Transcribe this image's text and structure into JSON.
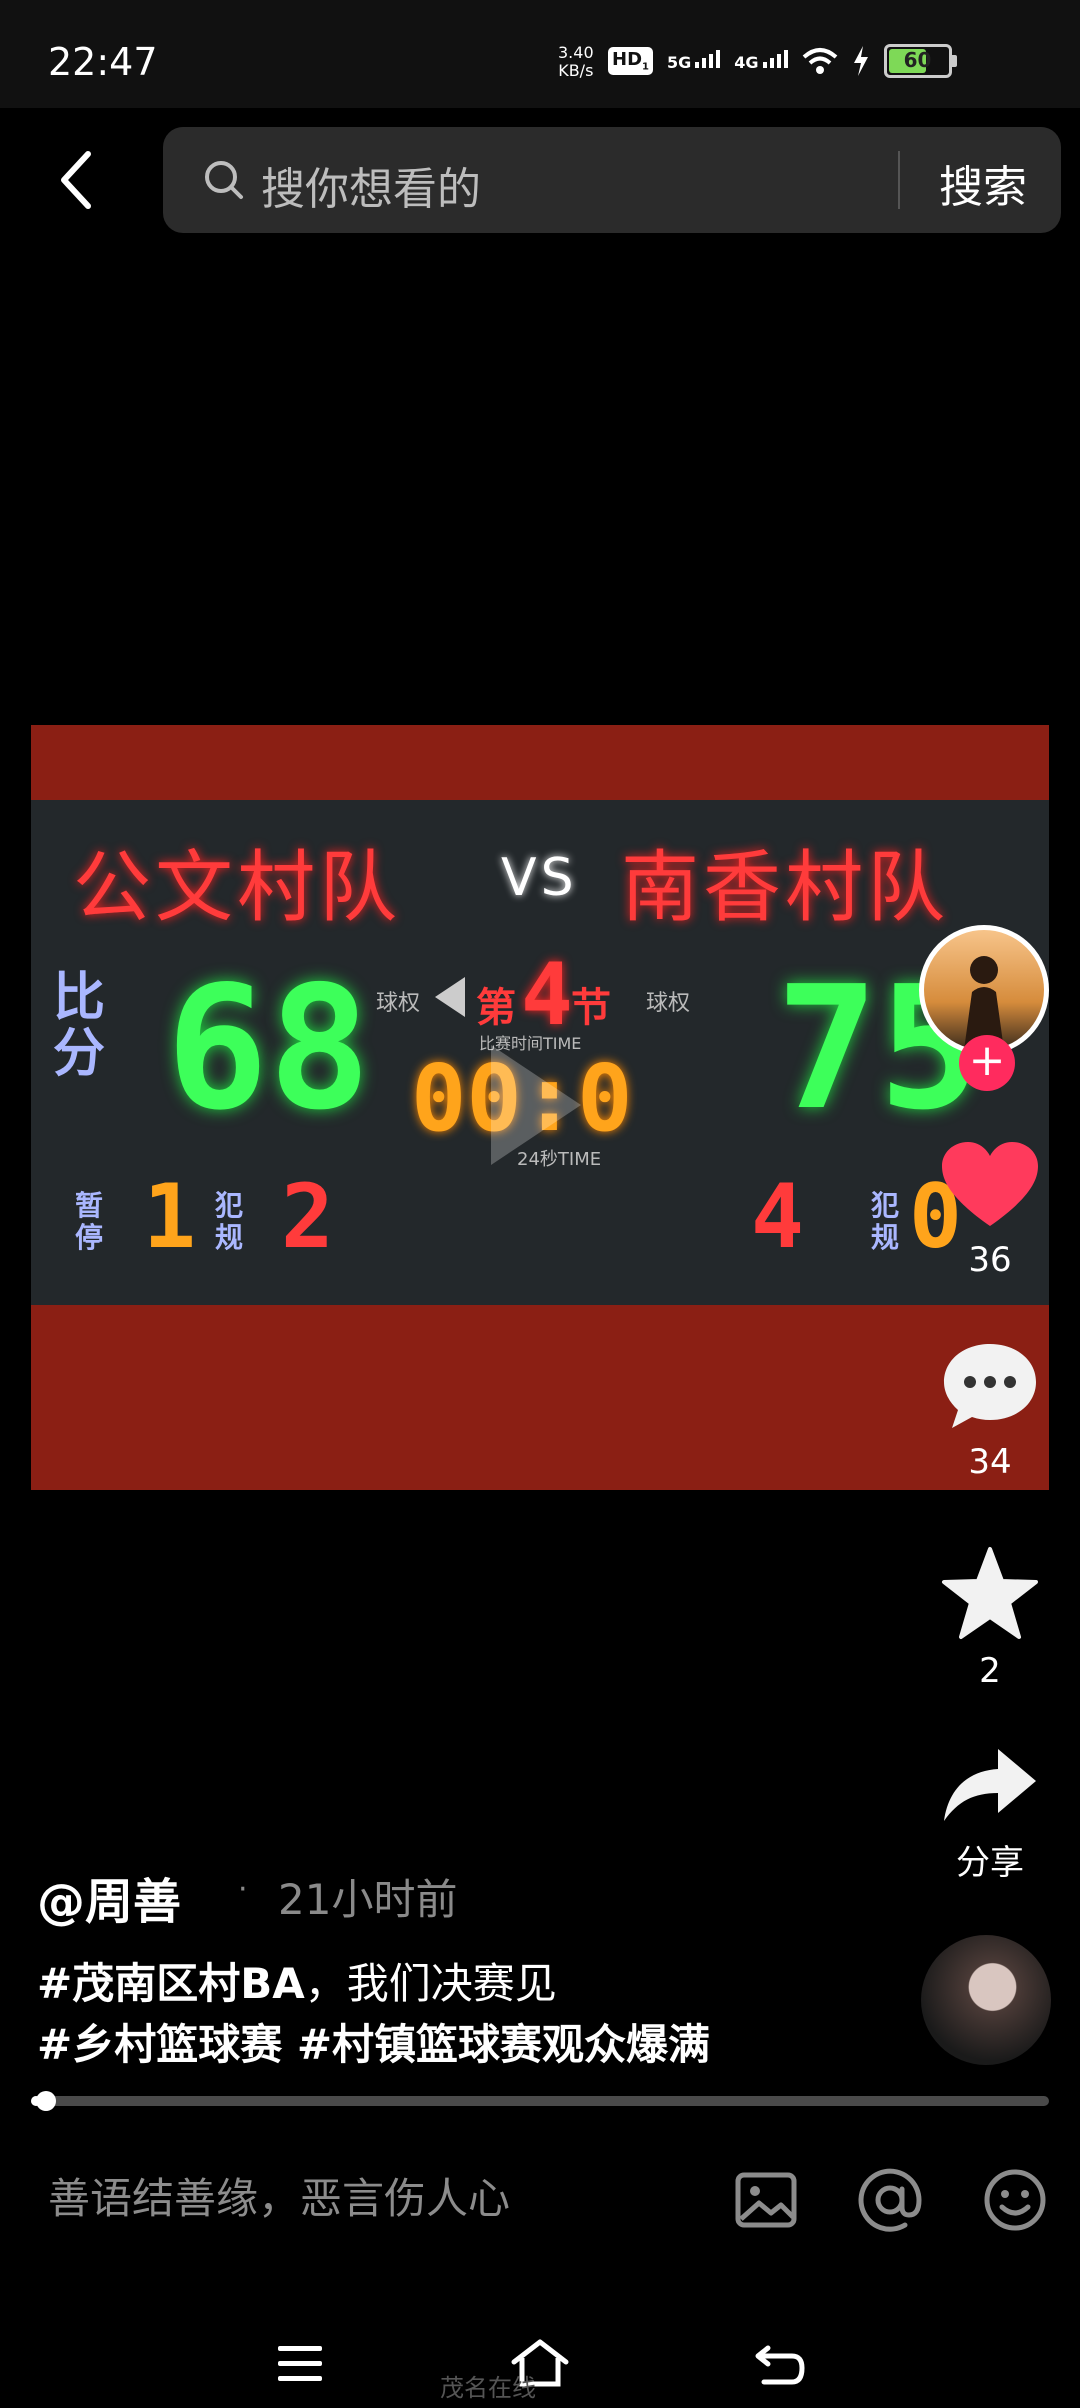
{
  "status_bar": {
    "time": "22:47",
    "net_speed_value": "3.40",
    "net_speed_unit": "KB/s",
    "hd": "HD",
    "hd_sub": "1",
    "net1": "5G",
    "net2": "4G",
    "battery": "60",
    "icons": [
      "wifi-icon",
      "charging-icon",
      "battery-icon"
    ]
  },
  "header": {
    "search_placeholder": "搜你想看的",
    "search_button": "搜索"
  },
  "video": {
    "banner_left": "公文村队",
    "banner_vs": "VS",
    "banner_right": "南香村队",
    "label_score": "比分",
    "possession": "球权",
    "period_prefix": "第",
    "period": "4",
    "period_suffix": "节",
    "score_home": "68",
    "score_away": "75",
    "game_time_label": "比赛时间TIME",
    "clock": "00:0",
    "shot_clock_label": "24秒TIME",
    "timeout_label": "暂停",
    "foul_label": "犯规",
    "home_timeouts": "1",
    "home_fouls": "2",
    "away_timeouts": "4",
    "away_fouls": "0"
  },
  "actions": {
    "likes": "36",
    "comments": "34",
    "favorites": "2",
    "share": "分享",
    "follow": "+"
  },
  "post": {
    "author": "@周善",
    "separator": "·",
    "time_ago": "21小时前",
    "caption_tag1": "#茂南区村BA",
    "caption_text1": "，我们决赛见",
    "caption_line2": "#乡村篮球赛 #村镇篮球赛观众爆满",
    "progress": 0.01
  },
  "comment_bar": {
    "placeholder": "善语结善缘，恶言伤人心"
  },
  "watermark": "茂名在线"
}
